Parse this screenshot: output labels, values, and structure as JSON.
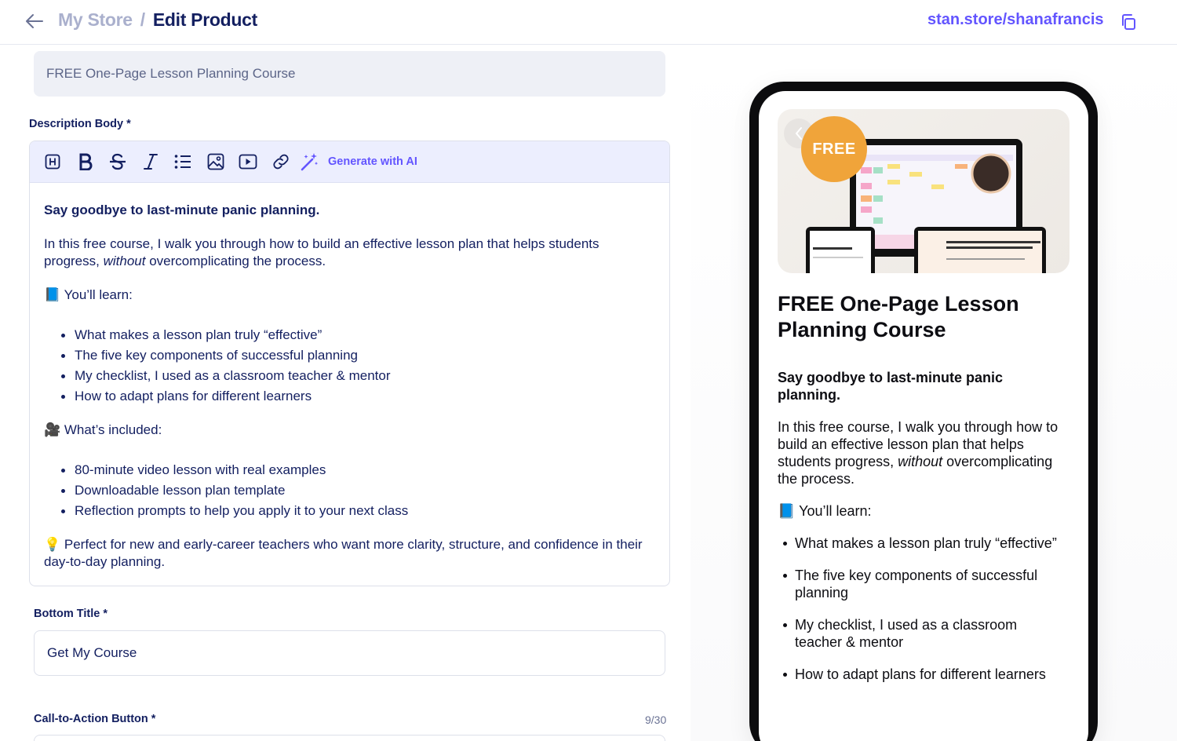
{
  "header": {
    "store_label": "My Store",
    "separator": "/",
    "page_title": "Edit Product",
    "store_url": "stan.store/shanafrancis"
  },
  "form": {
    "title_value": "FREE One-Page Lesson Planning Course",
    "description_label": "Description Body *",
    "toolbar": {
      "icons": [
        "heading-icon",
        "bold-icon",
        "strikethrough-icon",
        "italic-icon",
        "bullet-list-icon",
        "image-icon",
        "video-icon",
        "link-icon",
        "magic-wand-icon"
      ],
      "generate_ai_label": "Generate with AI"
    },
    "description": {
      "intro_bold": "Say goodbye to last-minute panic planning.",
      "para1_start": "In this free course, I walk you through how to build an effective lesson plan that helps students progress, ",
      "para1_italic": "without",
      "para1_end": " overcomplicating the process.",
      "learn_heading": "📘 You’ll learn:",
      "learn_items": [
        "What makes a lesson plan truly “effective”",
        "The five key components of successful planning",
        "My checklist, I used as a classroom teacher & mentor",
        "How to adapt plans for different learners"
      ],
      "included_heading": "🎥 What’s included:",
      "included_items": [
        "80-minute video lesson with real examples",
        "Downloadable lesson plan template",
        "Reflection prompts to help you apply it to your next class"
      ],
      "closing": "💡 Perfect for new and early-career teachers who want more clarity, structure, and confidence in their day-to-day planning."
    },
    "bottom_title_label": "Bottom Title *",
    "bottom_title_value": "Get My Course",
    "cta_label": "Call-to-Action Button *",
    "cta_counter": "9/30"
  },
  "preview": {
    "badge": "FREE",
    "title": "FREE One-Page Lesson Planning Course",
    "intro_bold": "Say goodbye to last-minute panic planning.",
    "para1_start": "In this free course, I walk you through how to build an effective lesson plan that helps students progress, ",
    "para1_italic": "without",
    "para1_end": " overcomplicating the process.",
    "learn_heading": "📘 You’ll learn:",
    "learn_items": [
      "What makes a lesson plan truly “effective”",
      "The five key components of successful planning",
      "My checklist, I used as a classroom teacher & mentor",
      "How to adapt plans for different learners"
    ]
  },
  "colors": {
    "accent": "#6355ff",
    "navy": "#131f60",
    "badge_orange": "#f0a43a",
    "toolbar_bg": "#eceefe"
  }
}
